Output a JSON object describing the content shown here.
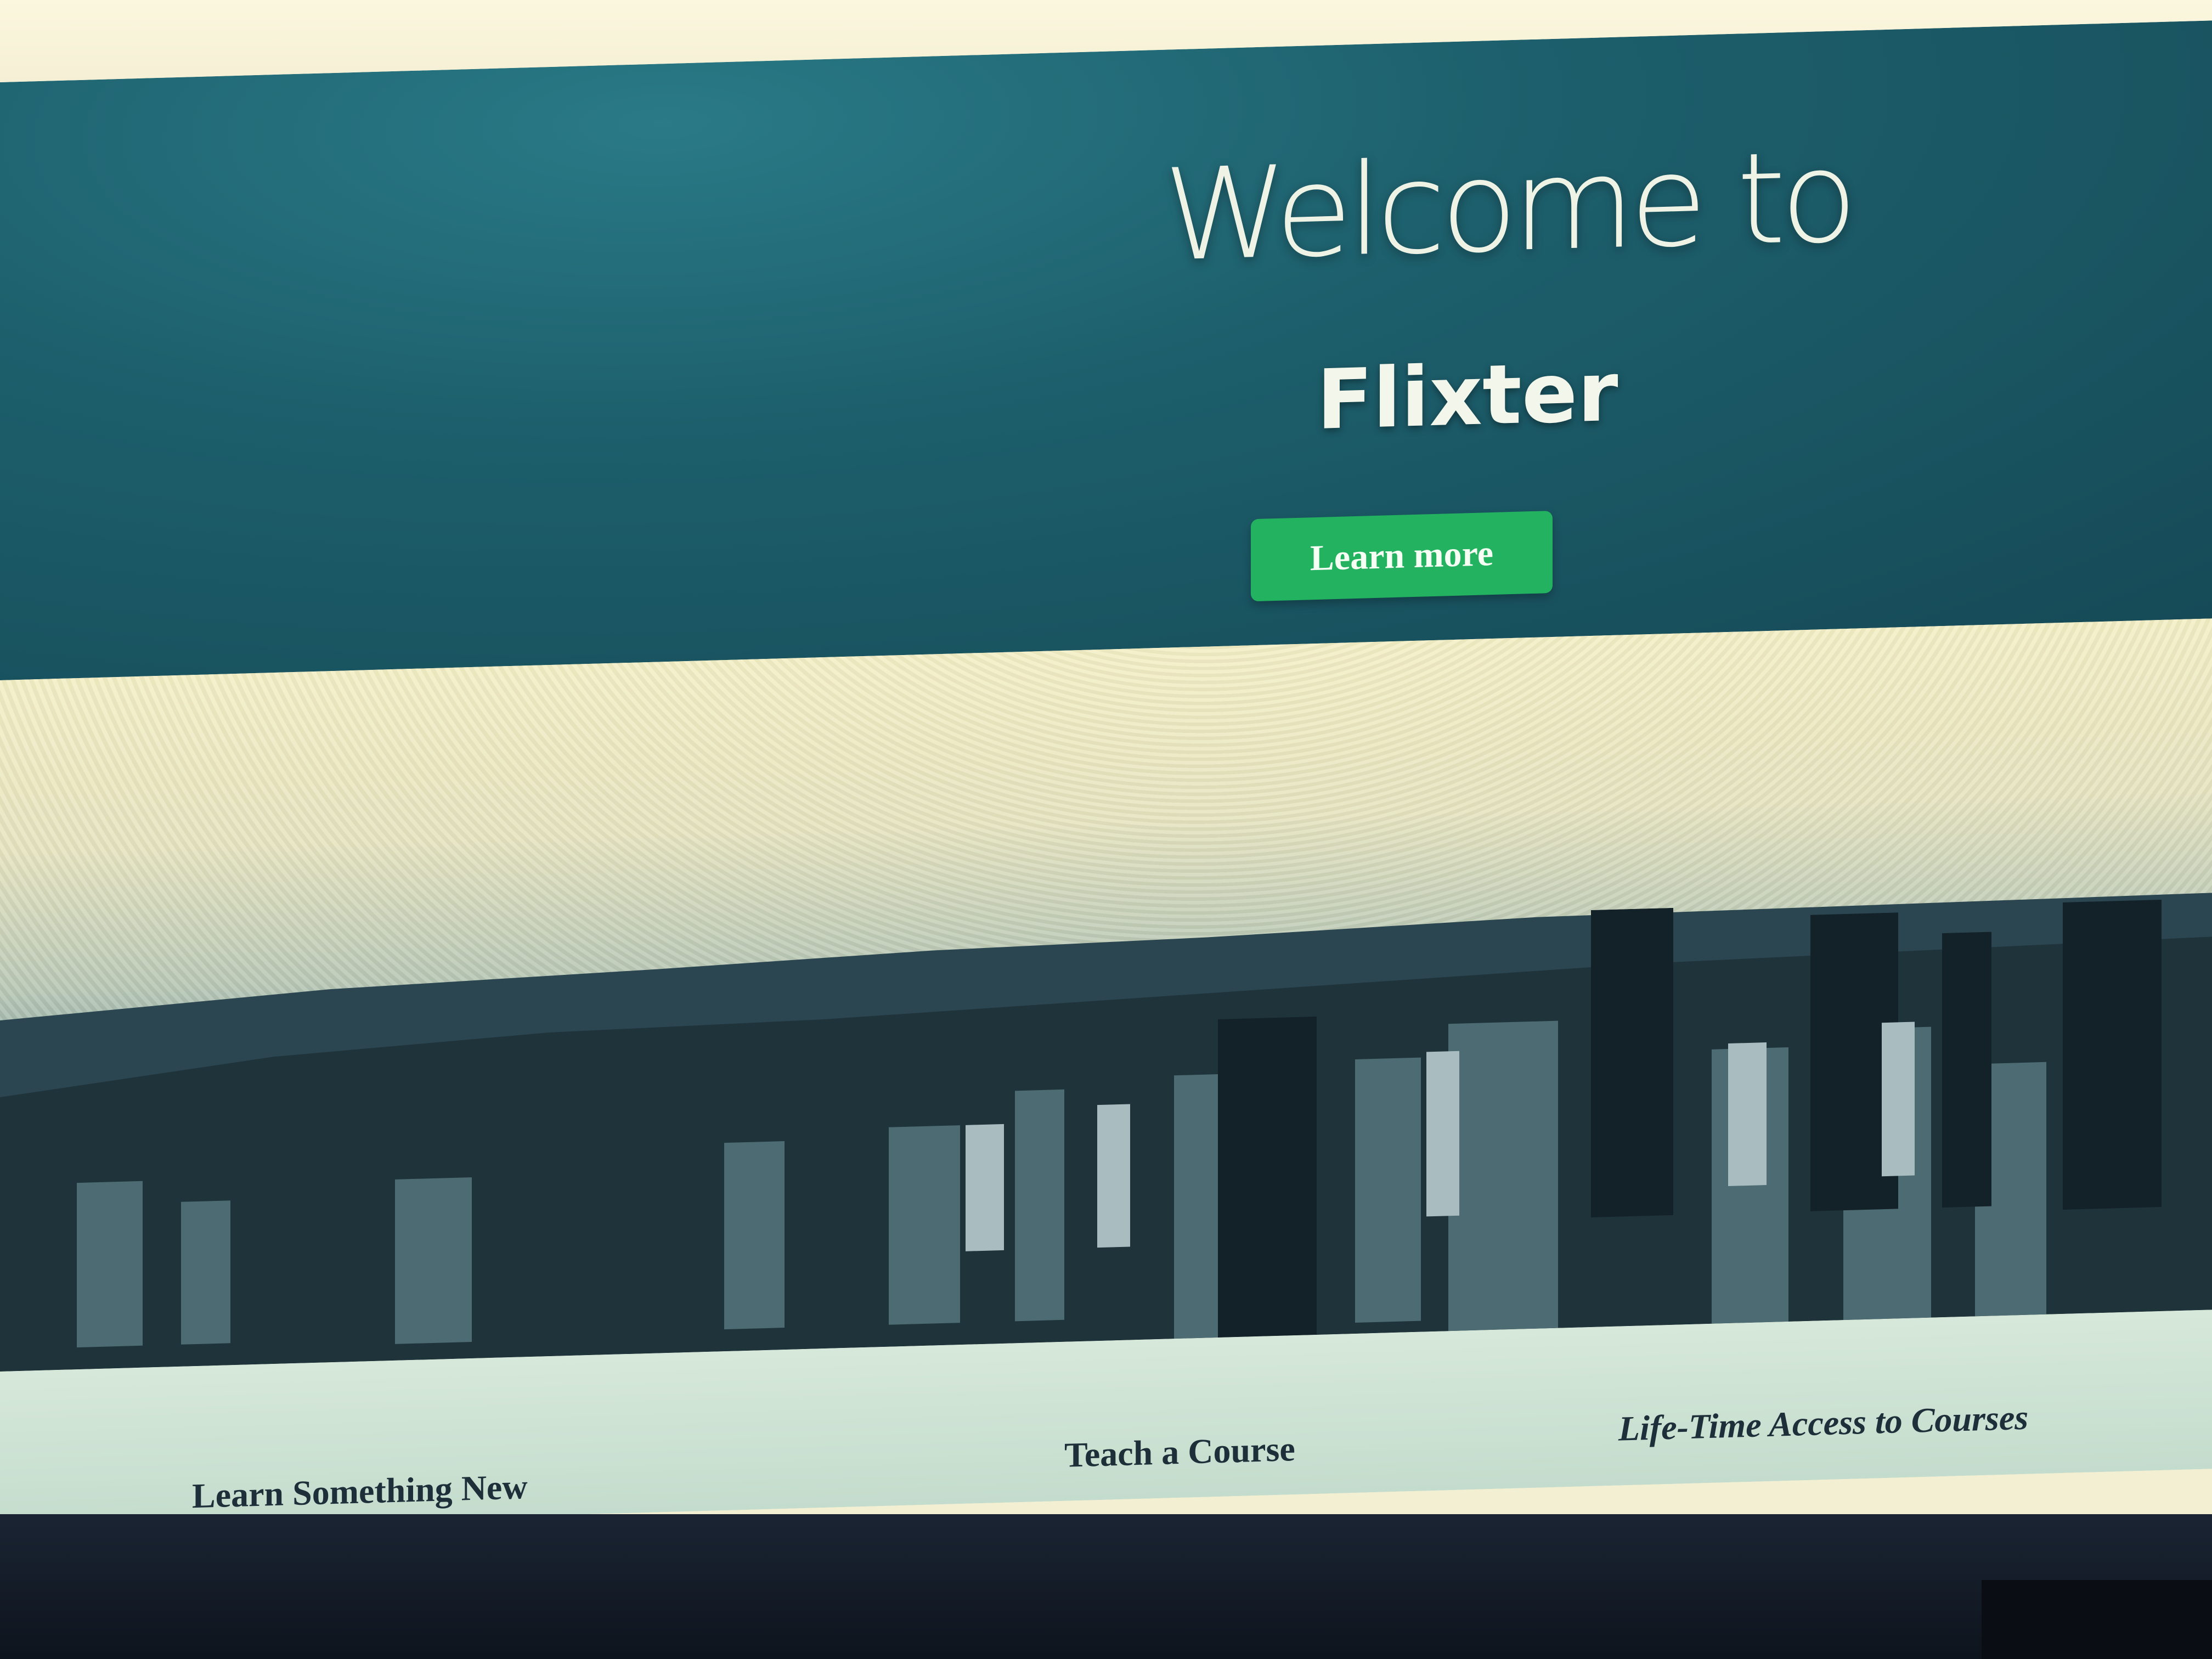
{
  "hero": {
    "title": "Welcome to",
    "brand": "Flixter",
    "cta_label": "Learn more"
  },
  "features": [
    {
      "label": "Learn Something New"
    },
    {
      "label": "Teach a Course"
    },
    {
      "label": "Life-Time Access to Courses"
    }
  ],
  "icons": {
    "cursor": "mouse-pointer-icon"
  },
  "colors": {
    "hero_bg": "#1d5f6c",
    "cta_bg": "#23b260",
    "feature_text": "#1f2f3a"
  }
}
